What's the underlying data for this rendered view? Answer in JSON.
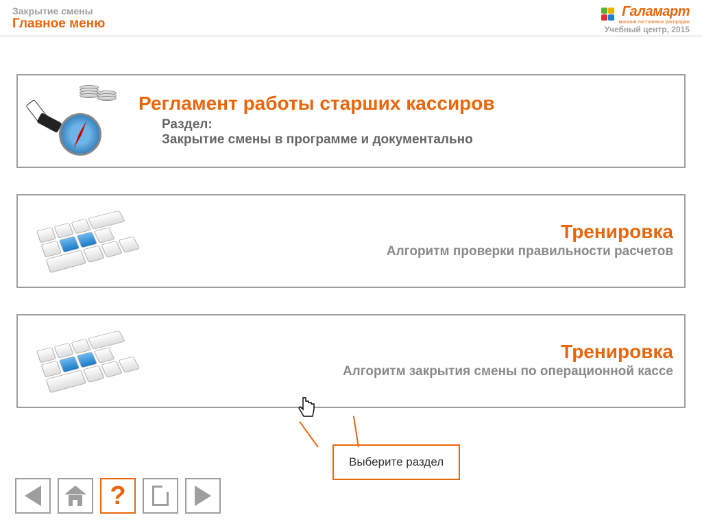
{
  "header": {
    "breadcrumb": "Закрытие смены",
    "title": "Главное меню",
    "brand_name": "Галамарт",
    "brand_tag": "магазин постоянных распродаж",
    "footer": "Учебный центр, 2015"
  },
  "cards": [
    {
      "title": "Регламент работы старших кассиров",
      "sub_label": "Раздел:",
      "sub_text": "Закрытие смены в программе и документально",
      "align": "left",
      "icon": "compass-dominoes"
    },
    {
      "title": "Тренировка",
      "subline": "Алгоритм проверки правильности расчетов",
      "align": "right",
      "icon": "keyboard"
    },
    {
      "title": "Тренировка",
      "subline": "Алгоритм закрытия смены по операционной кассе",
      "align": "right",
      "icon": "keyboard"
    }
  ],
  "callout": {
    "text": "Выберите раздел"
  },
  "nav": {
    "back": "◁",
    "home": "⌂",
    "help": "?",
    "doc": "▭",
    "forward": "▷"
  }
}
